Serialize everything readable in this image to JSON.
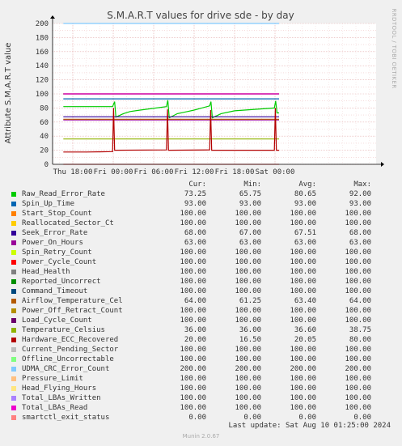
{
  "page_title": "S.M.A.R.T values for drive sde - by day",
  "side_label": "RRDTOOL / TOBI OETIKER",
  "footer": {
    "last_update": "Last update: Sat Aug 10 01:25:00 2024",
    "munin_version": "Munin 2.0.67"
  },
  "legend_headers": {
    "cur": "Cur:",
    "min": "Min:",
    "avg": "Avg:",
    "max": "Max:"
  },
  "chart_data": {
    "type": "line",
    "title": "S.M.A.R.T values for drive sde - by day",
    "ylabel": "Attribute S.M.A.R.T value",
    "ylim": [
      0,
      200
    ],
    "yticks": [
      0,
      20,
      40,
      60,
      80,
      100,
      120,
      140,
      160,
      180,
      200
    ],
    "xlim_hours": [
      -9,
      39
    ],
    "x_ticks": [
      {
        "label": "Thu 18:00",
        "hour": 18
      },
      {
        "label": "Fri 00:00",
        "hour": 24
      },
      {
        "label": "Fri 06:00",
        "hour": 30
      },
      {
        "label": "Fri 12:00",
        "hour": 36
      },
      {
        "label": "Fri 18:00",
        "hour": 42
      },
      {
        "label": "Sat 00:00",
        "hour": 48
      }
    ],
    "grid": true,
    "series": [
      {
        "name": "Raw_Read_Error_Rate",
        "color": "#00cc00",
        "cur": "73.25",
        "min": "65.75",
        "avg": "80.65",
        "max": "92.00",
        "points": [
          [
            16.6,
            82
          ],
          [
            23.9,
            82
          ],
          [
            24.2,
            89
          ],
          [
            24.4,
            67
          ],
          [
            25.5,
            72
          ],
          [
            26.5,
            75
          ],
          [
            28,
            77
          ],
          [
            31.9,
            82
          ],
          [
            32.1,
            91
          ],
          [
            32.3,
            66
          ],
          [
            33.5,
            72
          ],
          [
            35,
            75
          ],
          [
            36,
            77
          ],
          [
            38.3,
            83
          ],
          [
            38.5,
            89
          ],
          [
            38.7,
            66
          ],
          [
            40,
            72
          ],
          [
            42,
            76
          ],
          [
            47.9,
            80
          ],
          [
            48.1,
            90
          ],
          [
            48.3,
            73
          ],
          [
            48.6,
            73
          ]
        ]
      },
      {
        "name": "Spin_Up_Time",
        "color": "#0066b3",
        "cur": "93.00",
        "min": "93.00",
        "avg": "93.00",
        "max": "93.00",
        "constant": 93
      },
      {
        "name": "Start_Stop_Count",
        "color": "#ff8000",
        "cur": "100.00",
        "min": "100.00",
        "avg": "100.00",
        "max": "100.00",
        "constant": 100
      },
      {
        "name": "Reallocated_Sector_Ct",
        "color": "#ffcc00",
        "cur": "100.00",
        "min": "100.00",
        "avg": "100.00",
        "max": "100.00",
        "constant": 100
      },
      {
        "name": "Seek_Error_Rate",
        "color": "#330099",
        "cur": "68.00",
        "min": "67.00",
        "avg": "67.51",
        "max": "68.00",
        "constant": 67.5
      },
      {
        "name": "Power_On_Hours",
        "color": "#990099",
        "cur": "63.00",
        "min": "63.00",
        "avg": "63.00",
        "max": "63.00",
        "constant": 63
      },
      {
        "name": "Spin_Retry_Count",
        "color": "#ccff00",
        "cur": "100.00",
        "min": "100.00",
        "avg": "100.00",
        "max": "100.00",
        "constant": 100
      },
      {
        "name": "Power_Cycle_Count",
        "color": "#ff0000",
        "cur": "100.00",
        "min": "100.00",
        "avg": "100.00",
        "max": "100.00",
        "constant": 100
      },
      {
        "name": "Head_Health",
        "color": "#808080",
        "cur": "100.00",
        "min": "100.00",
        "avg": "100.00",
        "max": "100.00",
        "constant": 100
      },
      {
        "name": "Reported_Uncorrect",
        "color": "#008f00",
        "cur": "100.00",
        "min": "100.00",
        "avg": "100.00",
        "max": "100.00",
        "constant": 100
      },
      {
        "name": "Command_Timeout",
        "color": "#00487d",
        "cur": "100.00",
        "min": "100.00",
        "avg": "100.00",
        "max": "100.00",
        "constant": 100
      },
      {
        "name": "Airflow_Temperature_Cel",
        "color": "#b35a00",
        "cur": "64.00",
        "min": "61.25",
        "avg": "63.40",
        "max": "64.00",
        "constant": 64
      },
      {
        "name": "Power_Off_Retract_Count",
        "color": "#b38f00",
        "cur": "100.00",
        "min": "100.00",
        "avg": "100.00",
        "max": "100.00",
        "constant": 100
      },
      {
        "name": "Load_Cycle_Count",
        "color": "#6b006b",
        "cur": "100.00",
        "min": "100.00",
        "avg": "100.00",
        "max": "100.00",
        "constant": 100
      },
      {
        "name": "Temperature_Celsius",
        "color": "#8fb300",
        "cur": "36.00",
        "min": "36.00",
        "avg": "36.60",
        "max": "38.75",
        "constant": 36
      },
      {
        "name": "Hardware_ECC_Recovered",
        "color": "#b30000",
        "cur": "20.00",
        "min": "16.50",
        "avg": "20.05",
        "max": "80.00",
        "points": [
          [
            16.6,
            17.5
          ],
          [
            20,
            17.5
          ],
          [
            23.9,
            18
          ],
          [
            24.05,
            80
          ],
          [
            24.2,
            20
          ],
          [
            31.9,
            20.5
          ],
          [
            32.05,
            78
          ],
          [
            32.2,
            20
          ],
          [
            38.3,
            20.5
          ],
          [
            38.45,
            77
          ],
          [
            38.6,
            20
          ],
          [
            47.9,
            20
          ],
          [
            48.05,
            80
          ],
          [
            48.2,
            20
          ],
          [
            48.6,
            20
          ]
        ]
      },
      {
        "name": "Current_Pending_Sector",
        "color": "#bebebe",
        "cur": "100.00",
        "min": "100.00",
        "avg": "100.00",
        "max": "100.00",
        "constant": 100
      },
      {
        "name": "Offline_Uncorrectable",
        "color": "#80ff80",
        "cur": "100.00",
        "min": "100.00",
        "avg": "100.00",
        "max": "100.00",
        "constant": 100
      },
      {
        "name": "UDMA_CRC_Error_Count",
        "color": "#80c9ff",
        "cur": "200.00",
        "min": "200.00",
        "avg": "200.00",
        "max": "200.00",
        "constant": 200
      },
      {
        "name": "Pressure_Limit",
        "color": "#ffc080",
        "cur": "100.00",
        "min": "100.00",
        "avg": "100.00",
        "max": "100.00",
        "constant": 100
      },
      {
        "name": "Head_Flying_Hours",
        "color": "#ffe680",
        "cur": "100.00",
        "min": "100.00",
        "avg": "100.00",
        "max": "100.00",
        "constant": 100
      },
      {
        "name": "Total_LBAs_Written",
        "color": "#aa80ff",
        "cur": "100.00",
        "min": "100.00",
        "avg": "100.00",
        "max": "100.00",
        "constant": 100
      },
      {
        "name": "Total_LBAs_Read",
        "color": "#ee00cc",
        "cur": "100.00",
        "min": "100.00",
        "avg": "100.00",
        "max": "100.00",
        "constant": 100
      },
      {
        "name": "smartctl_exit_status",
        "color": "#ff8080",
        "cur": "0.00",
        "min": "0.00",
        "avg": "0.00",
        "max": "0.00",
        "constant": 0
      }
    ]
  }
}
